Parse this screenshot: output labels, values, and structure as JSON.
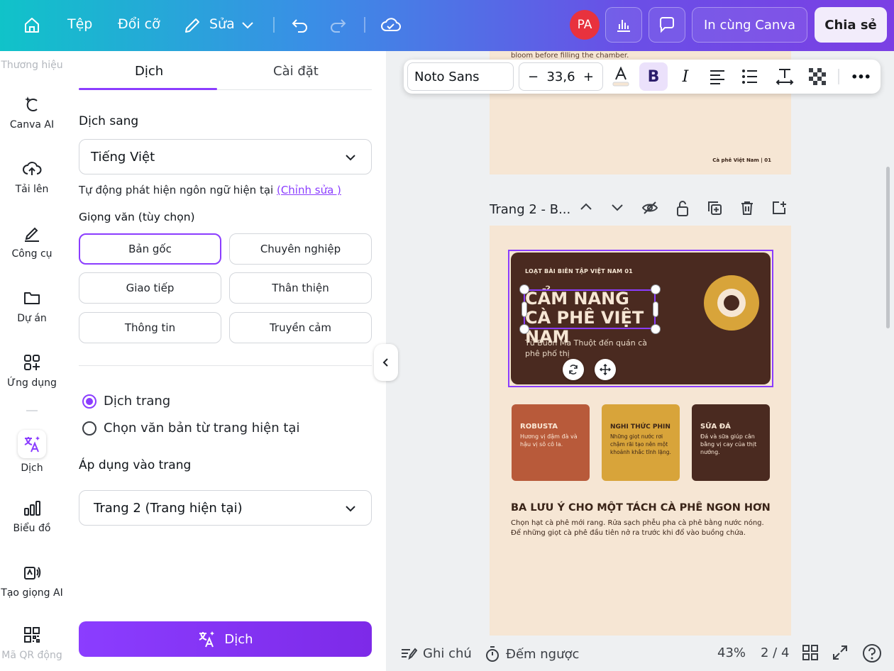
{
  "topbar": {
    "file_label": "Tệp",
    "resize_label": "Đổi cỡ",
    "edit_label": "Sửa",
    "avatar_initials": "PA",
    "print_label": "In cùng Canva",
    "share_label": "Chia sẻ"
  },
  "rail": {
    "brand": "Thương hiệu",
    "canva_ai": "Canva AI",
    "upload": "Tải lên",
    "tools": "Công cụ",
    "projects": "Dự án",
    "apps": "Ứng dụng",
    "translate": "Dịch",
    "charts": "Biểu đồ",
    "ai_voice": "Tạo giọng AI",
    "qr": "Mã QR động"
  },
  "panel": {
    "tab_translate": "Dịch",
    "tab_settings": "Cài đặt",
    "target_label": "Dịch sang",
    "target_value": "Tiếng Việt",
    "auto_detect": "Tự động phát hiện ngôn ngữ hiện tại",
    "edit_link": "(Chỉnh sửa )",
    "tone_label": "Giọng văn (tùy chọn)",
    "tones": [
      "Bản gốc",
      "Chuyên nghiệp",
      "Giao tiếp",
      "Thân thiện",
      "Thông tin",
      "Truyền cảm"
    ],
    "selected_tone": "Bản gốc",
    "scope_page": "Dịch trang",
    "scope_text": "Chọn văn bản từ trang hiện tại",
    "apply_label": "Áp dụng vào trang",
    "apply_value": "Trang 2 (Trang hiện tại)",
    "translate_button": "Dịch"
  },
  "toolbar": {
    "font": "Noto Sans",
    "size": "33,6",
    "minus": "−",
    "plus": "+",
    "bold": "B",
    "italic": "I",
    "more": "•••"
  },
  "page1": {
    "top_text": "bloom before filling the chamber.",
    "footer": "Cà phê Việt Nam | 01"
  },
  "page2": {
    "header": "Trang 2 - B...",
    "series": "LOẠT BÀI BIÊN TẬP VIỆT NAM 01",
    "title": "CẨM NANG CÀ PHÊ VIỆT NAM",
    "subtitle": "Từ Buôn Ma Thuột đến quán cà phê phố thị",
    "cards": [
      {
        "title": "ROBUSTA",
        "text": "Hương vị đậm đà và hậu vị sô cô la.",
        "color": "#b85a3a"
      },
      {
        "title": "NGHI THỨC PHIN",
        "text": "Những giọt nước rơi chậm rãi tạo nên một khoảnh khắc tĩnh lặng.",
        "color": "#d8a43a"
      },
      {
        "title": "SỮA ĐÁ",
        "text": "Đá và sữa giúp cân bằng vị cay của thịt nướng.",
        "color": "#4a2a20"
      }
    ],
    "section_title": "BA LƯU Ý CHO MỘT TÁCH CÀ PHÊ NGON HƠN",
    "section_text": "Chọn hạt cà phê mới rang. Rửa sạch phễu pha cà phê bằng nước nóng. Để những giọt cà phê đầu tiên nở ra trước khi đổ vào buồng chứa."
  },
  "bottom": {
    "notes": "Ghi chú",
    "timer": "Đếm ngược",
    "zoom": "43%",
    "pages": "2 / 4"
  },
  "colors": {
    "accent": "#8b3dff",
    "page_bg": "#f6e6d4",
    "hero_bg": "#4a2a20"
  }
}
